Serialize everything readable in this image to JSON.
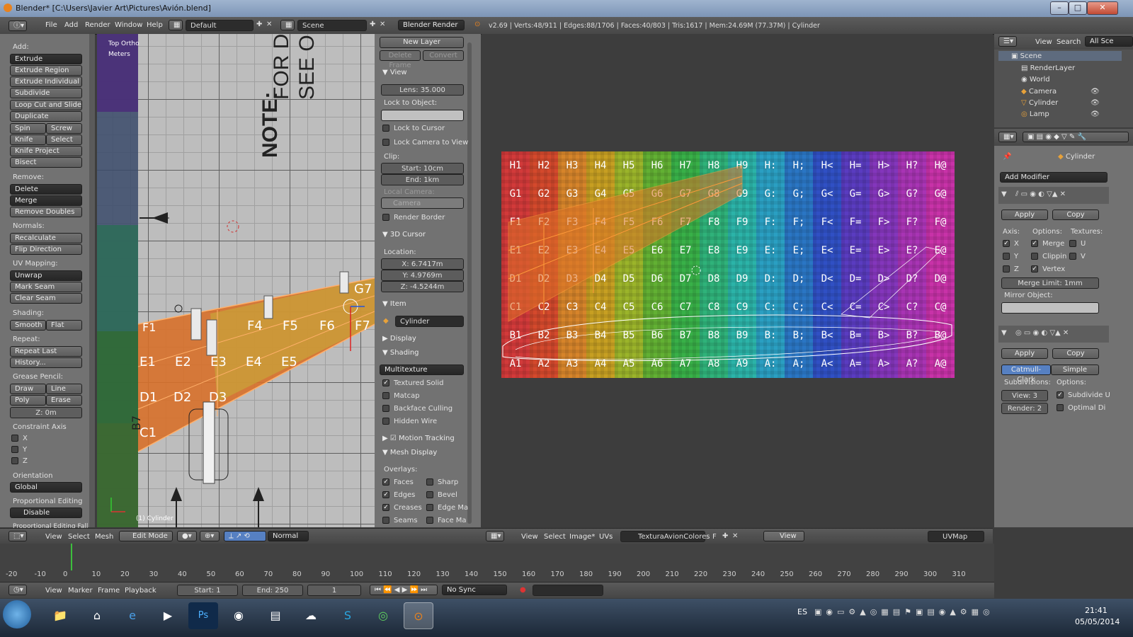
{
  "window": {
    "title": "Blender* [C:\\Users\\Javier Art\\Pictures\\Avión.blend]",
    "controls": [
      "–",
      "□",
      "✕"
    ]
  },
  "info_header": {
    "menus": [
      "File",
      "Add",
      "Render",
      "Window",
      "Help"
    ],
    "layout": "Default",
    "scene": "Scene",
    "engine": "Blender Render",
    "stats": "v2.69 | Verts:48/911 | Edges:88/1706 | Faces:40/803 | Tris:1617 | Mem:24.69M (77.37M) | Cylinder"
  },
  "toolshelf": {
    "add_label": "Add:",
    "extrude": "Extrude",
    "extrude_region": "Extrude Region",
    "extrude_individual": "Extrude Individual",
    "subdivide": "Subdivide",
    "loop_cut": "Loop Cut and Slide",
    "duplicate": "Duplicate",
    "spin": "Spin",
    "screw": "Screw",
    "knife": "Knife",
    "select": "Select",
    "knife_project": "Knife Project",
    "bisect": "Bisect",
    "remove_label": "Remove:",
    "delete": "Delete",
    "merge": "Merge",
    "remove_doubles": "Remove Doubles",
    "normals_label": "Normals:",
    "recalculate": "Recalculate",
    "flip_direction": "Flip Direction",
    "uv_label": "UV Mapping:",
    "unwrap": "Unwrap",
    "mark_seam": "Mark Seam",
    "clear_seam": "Clear Seam",
    "shading_label": "Shading:",
    "smooth": "Smooth",
    "flat": "Flat",
    "repeat_label": "Repeat:",
    "repeat_last": "Repeat Last",
    "history": "History...",
    "grease_label": "Grease Pencil:",
    "draw": "Draw",
    "line": "Line",
    "poly": "Poly",
    "erase": "Erase",
    "z_field": "Z: 0m",
    "constraint_label": "Constraint Axis",
    "axes": [
      "X",
      "Y",
      "Z"
    ],
    "orientation_label": "Orientation",
    "orientation": "Global",
    "prop_edit_label": "Proportional Editing",
    "prop_edit": "Disable",
    "prop_edit_falloff": "Proportional Editing Fall"
  },
  "viewport": {
    "view_name": "Top Ortho",
    "units": "Meters",
    "object_label": "(1) Cylinder",
    "blueprint_text_1": "NOTE:",
    "blueprint_text_2": "FOR D",
    "blueprint_text_3": "SEE O",
    "wing_labels": [
      "F1",
      "F4",
      "F5",
      "F6",
      "F7",
      "E1",
      "E2",
      "E3",
      "E4",
      "E5",
      "D1",
      "D2",
      "D3",
      "C1",
      "G7",
      "B7"
    ]
  },
  "properties": {
    "new_layer": "New Layer",
    "delete_frame": "Delete Frame",
    "convert": "Convert",
    "view_header": "View",
    "lens": "Lens: 35.000",
    "lock_to_object": "Lock to Object:",
    "lock_to_cursor": "Lock to Cursor",
    "lock_camera": "Lock Camera to View",
    "clip_label": "Clip:",
    "clip_start": "Start: 10cm",
    "clip_end": "End: 1km",
    "local_camera": "Local Camera:",
    "camera": "Camera",
    "render_border": "Render Border",
    "cursor_header": "3D Cursor",
    "location_label": "Location:",
    "loc_x": "X: 6.7417m",
    "loc_y": "Y: 4.9769m",
    "loc_z": "Z: -4.5244m",
    "item_header": "Item",
    "item_name": "Cylinder",
    "display_header": "Display",
    "shading_header": "Shading",
    "shading_mode": "Multitexture",
    "textured_solid": "Textured Solid",
    "matcap": "Matcap",
    "backface_culling": "Backface Culling",
    "hidden_wire": "Hidden Wire",
    "motion_tracking": "Motion Tracking",
    "mesh_display": "Mesh Display",
    "overlays_label": "Overlays:",
    "faces": "Faces",
    "sharp": "Sharp",
    "edges": "Edges",
    "bevel": "Bevel",
    "creases": "Creases",
    "edge_marks": "Edge Ma",
    "seams": "Seams",
    "face_marks": "Face Ma"
  },
  "viewport_header": {
    "menus": [
      "View",
      "Select",
      "Mesh"
    ],
    "mode": "Edit Mode",
    "orientation": "Normal"
  },
  "uv_editor": {
    "rows": [
      [
        "H1",
        "H2",
        "H3",
        "H4",
        "H5",
        "H6",
        "H7",
        "H8",
        "H9",
        "H:",
        "H;",
        "H<",
        "H=",
        "H>",
        "H?",
        "H@"
      ],
      [
        "G1",
        "G2",
        "G3",
        "G4",
        "G5",
        "G6",
        "G7",
        "G8",
        "G9",
        "G:",
        "G;",
        "G<",
        "G=",
        "G>",
        "G?",
        "G@"
      ],
      [
        "F1",
        "F2",
        "F3",
        "F4",
        "F5",
        "F6",
        "F7",
        "F8",
        "F9",
        "F:",
        "F;",
        "F<",
        "F=",
        "F>",
        "F?",
        "F@"
      ],
      [
        "E1",
        "E2",
        "E3",
        "E4",
        "E5",
        "E6",
        "E7",
        "E8",
        "E9",
        "E:",
        "E;",
        "E<",
        "E=",
        "E>",
        "E?",
        "E@"
      ],
      [
        "D1",
        "D2",
        "D3",
        "D4",
        "D5",
        "D6",
        "D7",
        "D8",
        "D9",
        "D:",
        "D;",
        "D<",
        "D=",
        "D>",
        "D?",
        "D@"
      ],
      [
        "C1",
        "C2",
        "C3",
        "C4",
        "C5",
        "C6",
        "C7",
        "C8",
        "C9",
        "C:",
        "C;",
        "C<",
        "C=",
        "C>",
        "C?",
        "C@"
      ],
      [
        "B1",
        "B2",
        "B3",
        "B4",
        "B5",
        "B6",
        "B7",
        "B8",
        "B9",
        "B:",
        "B;",
        "B<",
        "B=",
        "B>",
        "B?",
        "B@"
      ],
      [
        "A1",
        "A2",
        "A3",
        "A4",
        "A5",
        "A6",
        "A7",
        "A8",
        "A9",
        "A:",
        "A;",
        "A<",
        "A=",
        "A>",
        "A?",
        "A@"
      ]
    ],
    "column_colors": [
      "#d23a3a",
      "#d4492c",
      "#d6842a",
      "#c79f22",
      "#9bb42a",
      "#62b033",
      "#38b048",
      "#2fb27a",
      "#2bb3a8",
      "#2a9fc2",
      "#2a76c4",
      "#3050c4",
      "#5a3cc0",
      "#8436bc",
      "#a834b4",
      "#c832a8"
    ],
    "header_menus": [
      "View",
      "Select",
      "Image*",
      "UVs"
    ],
    "image_name": "TexturaAvionColores",
    "view_btn": "View",
    "uvmap": "UVMap"
  },
  "outliner": {
    "menus": [
      "View",
      "Search"
    ],
    "filter": "All Sce",
    "items": [
      "Scene",
      "RenderLayer",
      "World",
      "Camera",
      "Cylinder",
      "Lamp"
    ]
  },
  "modifiers": {
    "object": "Cylinder",
    "add_modifier": "Add Modifier",
    "apply": "Apply",
    "copy": "Copy",
    "axis_label": "Axis:",
    "options_label": "Options:",
    "textures_label": "Textures:",
    "x": "X",
    "y": "Y",
    "z": "Z",
    "merge": "Merge",
    "clipping": "Clippin",
    "vertex": "Vertex",
    "u": "U",
    "v": "V",
    "merge_limit": "Merge Limit: 1mm",
    "mirror_object": "Mirror Object:",
    "apply2": "Apply",
    "copy2": "Copy",
    "catmull": "Catmull-Clark",
    "simple": "Simple",
    "subdivisions_label": "Subdivisions:",
    "options2_label": "Options:",
    "view_levels": "View: 3",
    "render_levels": "Render: 2",
    "subdivide_uvs": "Subdivide U",
    "optimal_display": "Optimal Di"
  },
  "timeline": {
    "ticks": [
      "-20",
      "-10",
      "0",
      "10",
      "20",
      "30",
      "40",
      "50",
      "60",
      "70",
      "80",
      "90",
      "100",
      "110",
      "120",
      "130",
      "140",
      "150",
      "160",
      "170",
      "180",
      "190",
      "200",
      "210",
      "220",
      "230",
      "240",
      "250",
      "260",
      "270",
      "280",
      "290",
      "300",
      "310"
    ],
    "menus": [
      "View",
      "Marker",
      "Frame",
      "Playback"
    ],
    "start": "Start: 1",
    "end": "End: 250",
    "current": "1",
    "sync": "No Sync"
  },
  "taskbar": {
    "language": "ES",
    "time": "21:41",
    "date": "05/05/2014"
  },
  "colors": {
    "accent_blue": "#5680c2",
    "wing_orange": "#e0722a"
  }
}
